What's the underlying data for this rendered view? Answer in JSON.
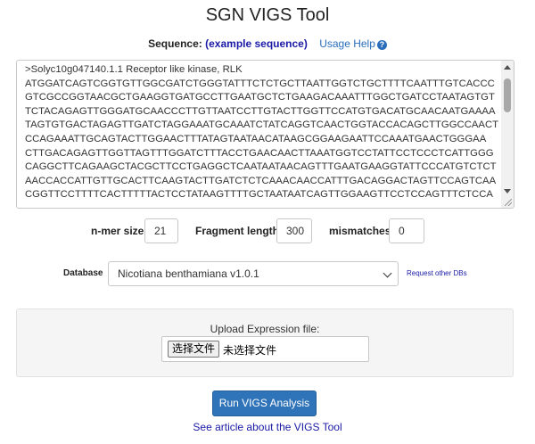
{
  "page": {
    "title": "SGN VIGS Tool"
  },
  "sequence": {
    "label": "Sequence:",
    "example_link": "(example sequence)",
    "help_link": "Usage Help",
    "help_icon": "question-circle-icon",
    "lines": [
      ">Solyc10g047140.1.1 Receptor like kinase, RLK",
      "ATGGATCAGTCGGTGTTGGCGATCTGGGTATTTCTCTGCTTAATTGGTCTGCTTTTCAATTTGTCACCC",
      "GTCGCCGGTAACGCTGAAGGTGATGCCTTGAATGCTCTGAAGACAAATTTGGCTGATCCTAATAGTGT",
      "TCTACAGAGTTGGGATGCAACCCTTGTTAATCCTTGTACTTGGTTCCATGTGACATGCAACAATGAAAA",
      "TAGTGTGACTAGAGTTGATCTAGGAAATGCAAATCTATCAGGTCAACTGGTACCACAGCTTGGCCAACT",
      "CCAGAAATTGCAGTACTTGGAACTTTATAGTAATAACATAAGCGGAAGAATTCCAAATGAACTGGGAA",
      "CTTGACAGAGTTGGTTAGTTTGGATCTTTACCTGAACAACTTAAATGGTCCTATTCCTCCCTCATTGGG",
      "CAGGCTTCAGAAGCTACGCTTCCTGAGGCTCAATAATAACAGTTTGAATGAAGGTATTCCCATGTCTCT",
      "AACCACCATTGTTGCACTTCAAGTACTTGATCTCTCAAACAACCATTTGACAGGACTAGTTCCAGTCAA",
      "CGGTTCCTTTTCACTTTTTACTCCTATAAGTTTTGCTAATAATCAGTTGGAAGTTCCTCCAGTTTCTCCA"
    ]
  },
  "params": {
    "nmer_label": "n-mer size",
    "nmer_value": "21",
    "fragment_label": "Fragment length",
    "fragment_value": "300",
    "mismatches_label": "mismatches",
    "mismatches_value": "0"
  },
  "database": {
    "label": "Database",
    "selected": "Nicotiana benthamiana v1.0.1",
    "request_link": "Request other DBs"
  },
  "upload": {
    "label": "Upload Expression file:",
    "button": "选择文件",
    "status": "未选择文件"
  },
  "actions": {
    "run_button": "Run VIGS Analysis",
    "article_link": "See article about the VIGS Tool"
  },
  "colors": {
    "primary_button": "#2f74b8",
    "link": "#1a1aa6",
    "help_link": "#2a6ebb"
  }
}
